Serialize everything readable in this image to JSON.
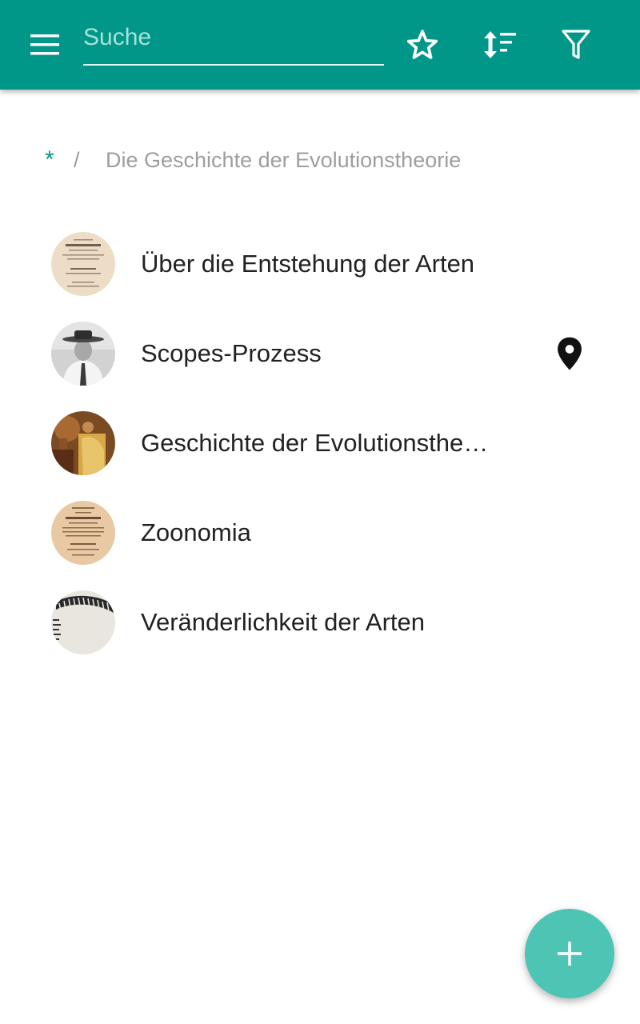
{
  "app_bar": {
    "background_color": "#009688",
    "menu_icon": "hamburger-menu-icon",
    "search": {
      "placeholder": "Suche",
      "value": ""
    },
    "actions": [
      {
        "icon": "star-outline-icon"
      },
      {
        "icon": "sort-icon"
      },
      {
        "icon": "filter-icon"
      }
    ]
  },
  "breadcrumb": {
    "root": "*",
    "separator": "/",
    "current": "Die Geschichte der Evolutionstheorie"
  },
  "list": {
    "items": [
      {
        "label": "Über die Entstehung der Arten",
        "thumbnail": "book-title-page-thumbnail",
        "has_location": false
      },
      {
        "label": "Scopes-Prozess",
        "thumbnail": "man-in-hat-photo-thumbnail",
        "has_location": true
      },
      {
        "label": "Geschichte der Evolutionsthe…",
        "thumbnail": "painting-thumbnail",
        "has_location": false
      },
      {
        "label": "Zoonomia",
        "thumbnail": "book-title-page-thumbnail",
        "has_location": false
      },
      {
        "label": "Veränderlichkeit der Arten",
        "thumbnail": "illustration-thumbnail",
        "has_location": false
      }
    ]
  },
  "fab": {
    "icon": "plus-icon",
    "color": "#4dc4b4"
  }
}
